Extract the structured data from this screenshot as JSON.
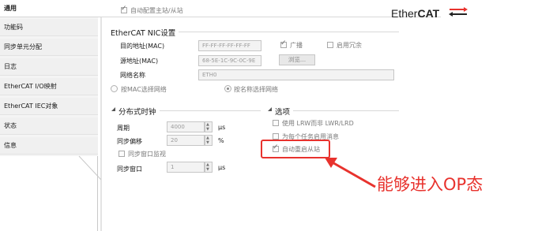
{
  "sidebar": {
    "items": [
      {
        "label": "通用",
        "active": true
      },
      {
        "label": "功能码"
      },
      {
        "label": "同步单元分配"
      },
      {
        "label": "日志"
      },
      {
        "label": "EtherCAT I/O映射"
      },
      {
        "label": "EtherCAT IEC对象"
      },
      {
        "label": "状态"
      },
      {
        "label": "信息"
      }
    ]
  },
  "top": {
    "auto_config_label": "自动配置主站/从站",
    "auto_config_checked": true,
    "logo_text_light": "Ether",
    "logo_text_bold": "CAT"
  },
  "nic": {
    "title": "EtherCAT NIC设置",
    "dest_label": "目的地址(MAC)",
    "dest_value": "FF-FF-FF-FF-FF-FF",
    "broadcast_label": "广播",
    "broadcast_checked": true,
    "redundancy_label": "启用冗余",
    "redundancy_checked": false,
    "source_label": "源地址(MAC)",
    "source_value": "68-5E-1C-9C-0C-9E",
    "browse_label": "浏览...",
    "net_name_label": "网络名称",
    "net_name_value": "ETH0",
    "select_by_mac": "按MAC选择网络",
    "select_by_name": "按名称选择网络",
    "selected_mode": "name"
  },
  "dc": {
    "title": "分布式时钟",
    "period_label": "周期",
    "period_value": "4000",
    "period_unit": "µs",
    "offset_label": "同步偏移",
    "offset_value": "20",
    "offset_unit": "%",
    "watchdog_label": "同步窗口监视",
    "watchdog_checked": false,
    "window_label": "同步窗口",
    "window_value": "1",
    "window_unit": "µs"
  },
  "options": {
    "title": "选项",
    "items": [
      {
        "label": "使用 LRW而非 LWR/LRD",
        "checked": false
      },
      {
        "label": "为每个任务启用消息",
        "checked": false
      },
      {
        "label": "自动重启从站",
        "checked": true
      }
    ]
  },
  "annotation": {
    "text": "能够进入OP态",
    "color": "#e8322d"
  }
}
